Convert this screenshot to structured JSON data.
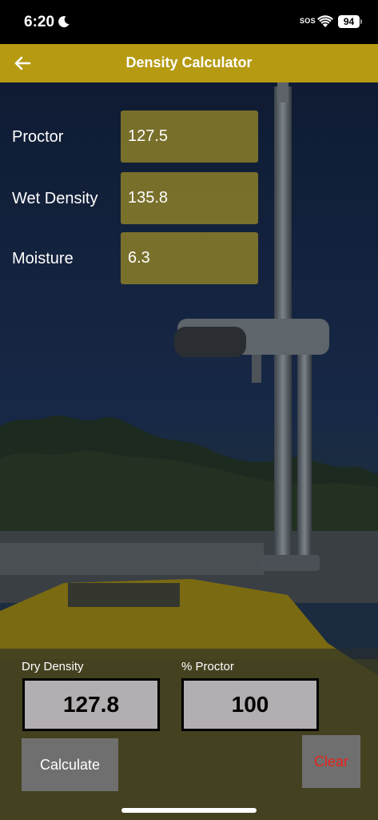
{
  "status_bar": {
    "time": "6:20",
    "sos": "SOS",
    "battery": "94"
  },
  "app_bar": {
    "title": "Density Calculator"
  },
  "form": {
    "proctor": {
      "label": "Proctor",
      "value": "127.5"
    },
    "wet_density": {
      "label": "Wet Density",
      "value": "135.8"
    },
    "moisture": {
      "label": "Moisture",
      "value": "6.3"
    }
  },
  "results": {
    "dry_density": {
      "label": "Dry Density",
      "value": "127.8"
    },
    "percent_proctor": {
      "label": "% Proctor",
      "value": "100"
    }
  },
  "buttons": {
    "calculate": "Calculate",
    "clear": "Clear"
  },
  "icons": {
    "back": "arrow-left-icon",
    "moon": "moon-icon",
    "wifi": "wifi-icon"
  },
  "colors": {
    "app_bar": "#b59a12",
    "input_fill": "#968728",
    "clear_text": "#e8231b",
    "result_box": "#b3aeb1"
  }
}
